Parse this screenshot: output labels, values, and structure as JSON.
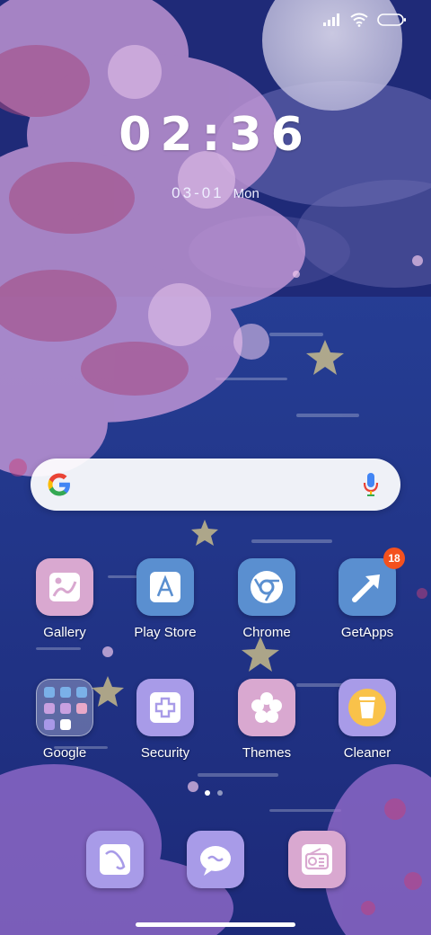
{
  "clock": {
    "time": "02:36"
  },
  "date": {
    "date": "03-01",
    "day": "Mon"
  },
  "search": {
    "placeholder": ""
  },
  "apps_row1": [
    {
      "label": "Gallery"
    },
    {
      "label": "Play Store"
    },
    {
      "label": "Chrome"
    },
    {
      "label": "GetApps",
      "badge": "18"
    }
  ],
  "apps_row2": [
    {
      "label": "Google"
    },
    {
      "label": "Security"
    },
    {
      "label": "Themes"
    },
    {
      "label": "Cleaner"
    }
  ],
  "page_indicator": {
    "current": 1,
    "total": 2
  },
  "colors": {
    "badge": "#f4511e",
    "pink_tile": "#d9a8d0",
    "blue_tile": "#5a8fd0",
    "purple_tile": "#a89be8"
  }
}
